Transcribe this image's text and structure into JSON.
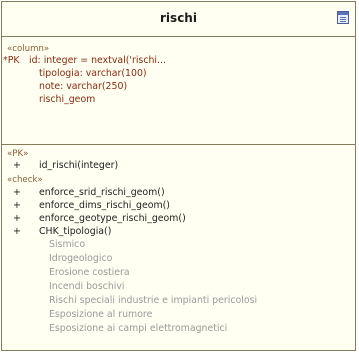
{
  "class": {
    "name": "rischi",
    "icon": "table-icon"
  },
  "columns": {
    "stereotype": "«column»",
    "pk_marker": "*PK",
    "items": [
      "id:  integer = nextval('rischi...",
      "tipologia:  varchar(100)",
      "note:  varchar(250)",
      "rischi_geom"
    ]
  },
  "pk": {
    "stereotype": "«PK»",
    "visibility": "+",
    "operations": [
      "id_rischi(integer)"
    ]
  },
  "check": {
    "stereotype": "«check»",
    "visibility": "+",
    "operations": [
      "enforce_srid_rischi_geom()",
      "enforce_dims_rischi_geom()",
      "enforce_geotype_rischi_geom()",
      "CHK_tipologia()"
    ],
    "values": [
      "Sismico",
      "Idrogeologico",
      "Erosione costiera",
      "Incendi boschivi",
      "Rischi speciali industrie e impianti pericolosi",
      "Esposizione al rumore",
      "Esposizione ai campi elettromagnetici"
    ]
  },
  "colors": {
    "box_fill": "#fffff2",
    "border": "#8a7a5c",
    "attribute_text": "#8b2a10",
    "operation_text": "#222222",
    "value_text": "#9a9a9a"
  }
}
